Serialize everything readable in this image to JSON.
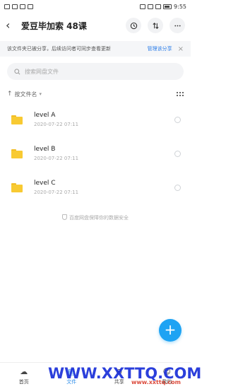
{
  "status_bar": {
    "time": "9:55"
  },
  "header": {
    "back_icon": "chevron-left-icon",
    "title": "爱豆毕加索 48课",
    "history_icon": "clock-history-icon",
    "sort_icon": "swap-vertical-icon",
    "more_icon": "more-dots-icon"
  },
  "notice": {
    "text": "该文件夹已被分享，后续访问者可同步查看更新",
    "link": "管理该分享",
    "close": "×"
  },
  "search": {
    "placeholder": "搜索网盘文件"
  },
  "sort": {
    "label": "按文件名",
    "arrow": "↑",
    "caret": "▾"
  },
  "files": [
    {
      "name": "level A",
      "date": "2020-07-22  07:11"
    },
    {
      "name": "level B",
      "date": "2020-07-22  07:11"
    },
    {
      "name": "level C",
      "date": "2020-07-22  07:11"
    }
  ],
  "safety_text": "百度网盘保障你的数据安全",
  "fab_label": "+",
  "bottom_nav": [
    {
      "label": "首页",
      "icon": "cloud-icon",
      "glyph": "☁"
    },
    {
      "label": "文件",
      "icon": "file-icon",
      "glyph": "▤"
    },
    {
      "label": "共享",
      "icon": "share-icon",
      "glyph": "⊗"
    },
    {
      "label": "我的",
      "icon": "user-icon",
      "glyph": "☺"
    }
  ],
  "watermark": {
    "text": "WWW.XXTTQ.COM",
    "small": "www.xxttq.com"
  },
  "colors": {
    "accent": "#2a8be8",
    "fab": "#1ea3f3",
    "folder": "#f8ca32",
    "watermark": "#1a2fd8"
  }
}
